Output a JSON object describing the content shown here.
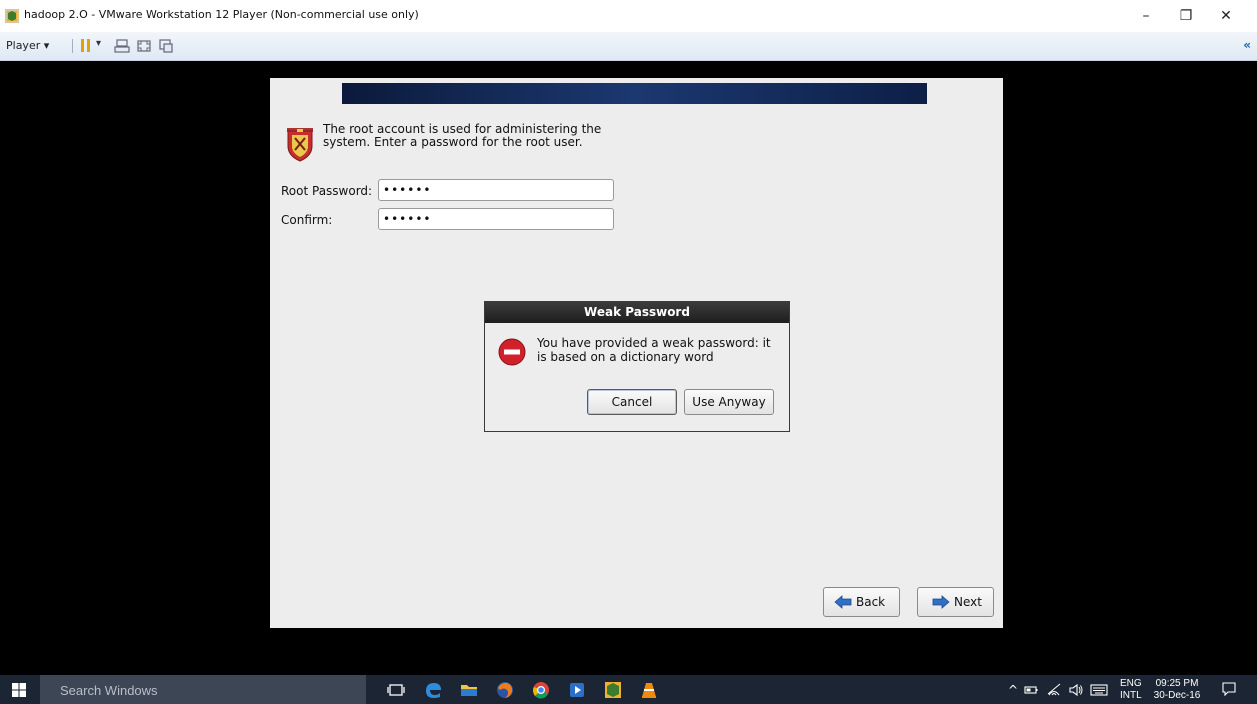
{
  "window": {
    "title": "hadoop 2.O - VMware Workstation 12 Player (Non-commercial use only)",
    "minimize": "–",
    "restore": "❐",
    "close": "✕"
  },
  "toolbar": {
    "player_label": "Player ▾",
    "caret": "▾",
    "collapse": "«"
  },
  "installer": {
    "intro": "The root account is used for administering the system.  Enter a password for the root user.",
    "root_password_label": "Root Password:",
    "root_password_value": "••••••",
    "confirm_label": "Confirm:",
    "confirm_value": "••••••",
    "back_label": "Back",
    "next_label": "Next"
  },
  "dialog": {
    "title": "Weak Password",
    "message": "You have provided a weak password: it is based on a dictionary word",
    "cancel_label": "Cancel",
    "use_anyway_label": "Use Anyway"
  },
  "taskbar": {
    "search_placeholder": "Search Windows",
    "lang_top": "ENG",
    "lang_bottom": "INTL",
    "time": "09:25 PM",
    "date": "30-Dec-16",
    "tray_up": "^"
  }
}
